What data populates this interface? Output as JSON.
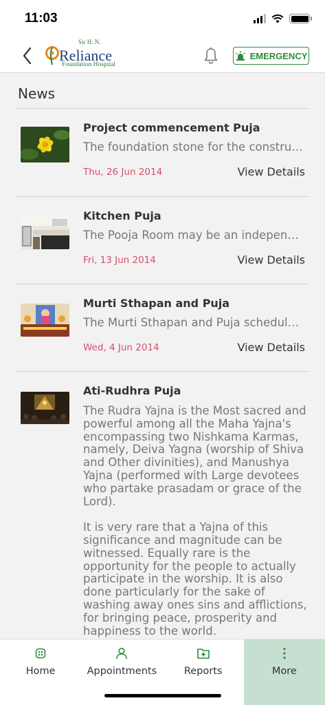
{
  "status_bar": {
    "time": "11:03"
  },
  "header": {
    "logo": {
      "prefix": "Sir H. N.",
      "name": "Reliance",
      "subtitle": "Foundation Hospital"
    },
    "emergency_label": "EMERGENCY"
  },
  "main": {
    "section_title": "News",
    "view_details_label": "View Details",
    "news": [
      {
        "title": "Project commencement Puja",
        "description": "The foundation stone for the construction of the new hospital",
        "date": "Thu, 26 Jun 2014"
      },
      {
        "title": "Kitchen Puja",
        "description": "The Pooja Room may be an independent space in the hospital",
        "date": "Fri, 13 Jun 2014"
      },
      {
        "title": "Murti Sthapan and Puja",
        "description": "The Murti Sthapan and Puja scheduled at the hospital premises",
        "date": "Wed, 4 Jun 2014"
      },
      {
        "title": "Ati-Rudhra Puja",
        "paragraph1": "The Rudra Yajna is the Most sacred and powerful among all the Maha Yajna's encompassing two Nishkama Karmas, namely, Deiva Yagna (worship of Shiva and Other divinities), and Manushya Yajna (performed with Large devotees who partake prasadam or grace of the Lord).",
        "paragraph2": "It is very rare that a Yajna of this significance and magnitude can be witnessed. Equally rare is the opportunity for the people to actually participate in the worship. It is also done particularly for the sake of washing away ones sins and afflictions, for bringing peace, prosperity and happiness to the world."
      }
    ]
  },
  "bottom_nav": {
    "items": [
      {
        "label": "Home",
        "icon": "home-icon"
      },
      {
        "label": "Appointments",
        "icon": "person-icon"
      },
      {
        "label": "Reports",
        "icon": "folder-plus-icon"
      },
      {
        "label": "More",
        "icon": "more-vertical-icon"
      }
    ],
    "active": "More"
  },
  "colors": {
    "brand_green": "#2e8b3a",
    "date_pink": "#d2506b",
    "active_tab_bg": "#c6dfd0"
  }
}
